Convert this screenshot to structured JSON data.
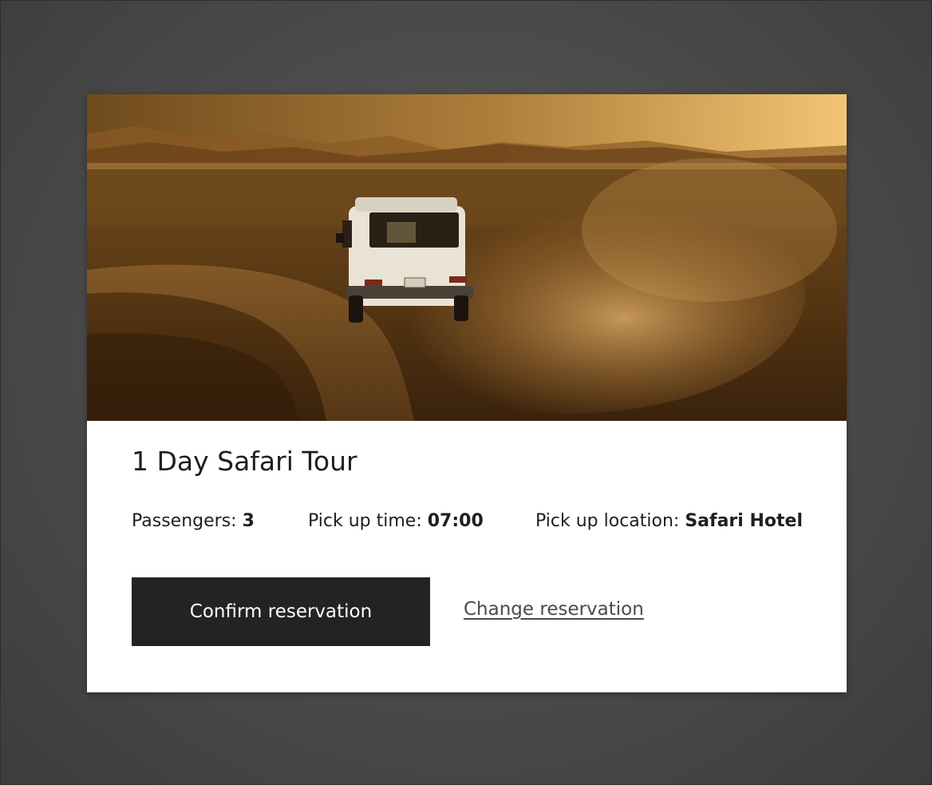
{
  "card": {
    "title": "1 Day Safari Tour",
    "details": {
      "passengers_label": "Passengers:",
      "passengers_value": "3",
      "pickup_time_label": "Pick up time:",
      "pickup_time_value": "07:00",
      "pickup_location_label": "Pick up location:",
      "pickup_location_value": "Safari Hotel"
    },
    "actions": {
      "confirm_label": "Confirm reservation",
      "change_label": "Change reservation"
    }
  },
  "colors": {
    "page_background": "#4a4a4a",
    "card_background": "#ffffff",
    "primary_button": "#232323",
    "primary_button_text": "#ffffff",
    "text": "#1f1f1f",
    "link": "#4a4a4a"
  }
}
